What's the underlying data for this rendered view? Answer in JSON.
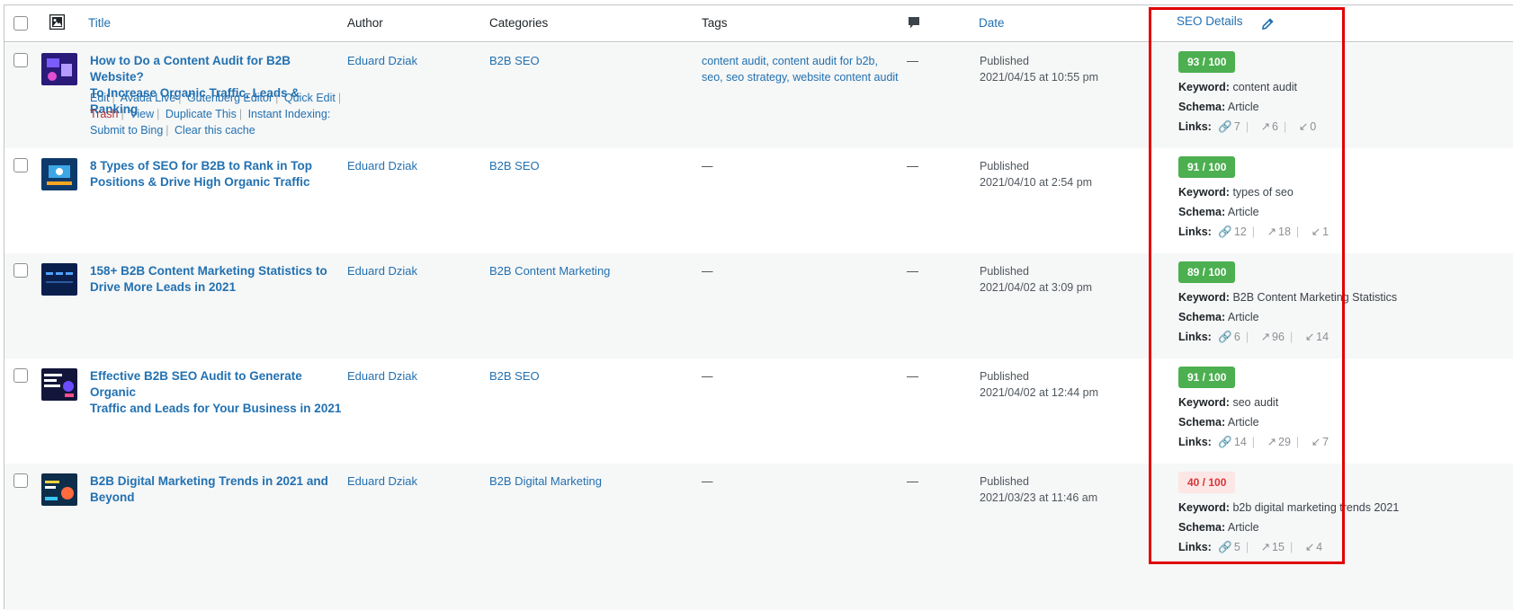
{
  "header": {
    "title": "Title",
    "author": "Author",
    "categories": "Categories",
    "tags": "Tags",
    "date": "Date",
    "seo_details": "SEO Details"
  },
  "rows": [
    {
      "title_line1": "How to Do a Content Audit for B2B Website?",
      "title_line2": "To Increase Organic Traffic, Leads & Ranking",
      "author": "Eduard Dziak",
      "category": "B2B SEO",
      "tags_line1": "content audit, content audit for b2b,",
      "tags_line2": "seo, seo strategy, website content audit",
      "comments": "—",
      "status": "Published",
      "date": "2021/04/15 at 10:55 pm",
      "score": "93 / 100",
      "keyword": "content audit",
      "schema": "Article",
      "links_internal": "7",
      "links_external": "6",
      "links_incoming": "0"
    },
    {
      "title_line1": "8 Types of SEO for B2B to Rank in Top",
      "title_line2": "Positions & Drive High Organic Traffic",
      "author": "Eduard Dziak",
      "category": "B2B SEO",
      "tags_line1": "—",
      "tags_line2": "",
      "comments": "—",
      "status": "Published",
      "date": "2021/04/10 at 2:54 pm",
      "score": "91 / 100",
      "keyword": "types of seo",
      "schema": "Article",
      "links_internal": "12",
      "links_external": "18",
      "links_incoming": "1"
    },
    {
      "title_line1": "158+ B2B Content Marketing Statistics to",
      "title_line2": "Drive More Leads in 2021",
      "author": "Eduard Dziak",
      "category": "B2B Content Marketing",
      "tags_line1": "—",
      "tags_line2": "",
      "comments": "—",
      "status": "Published",
      "date": "2021/04/02 at 3:09 pm",
      "score": "89 / 100",
      "keyword": "B2B Content Marketing Statistics",
      "schema": "Article",
      "links_internal": "6",
      "links_external": "96",
      "links_incoming": "14"
    },
    {
      "title_line1": "Effective B2B SEO Audit to Generate Organic",
      "title_line2": "Traffic and Leads for Your Business in 2021",
      "author": "Eduard Dziak",
      "category": "B2B SEO",
      "tags_line1": "—",
      "tags_line2": "",
      "comments": "—",
      "status": "Published",
      "date": "2021/04/02 at 12:44 pm",
      "score": "91 / 100",
      "keyword": "seo audit",
      "schema": "Article",
      "links_internal": "14",
      "links_external": "29",
      "links_incoming": "7"
    },
    {
      "title_line1": "B2B Digital Marketing Trends in 2021 and",
      "title_line2": "Beyond",
      "author": "Eduard Dziak",
      "category": "B2B Digital Marketing",
      "tags_line1": "—",
      "tags_line2": "",
      "comments": "—",
      "status": "Published",
      "date": "2021/03/23 at 11:46 am",
      "score": "40 / 100",
      "keyword": "b2b digital marketing trends 2021",
      "schema": "Article",
      "links_internal": "5",
      "links_external": "15",
      "links_incoming": "4"
    }
  ],
  "row_actions": {
    "edit": "Edit",
    "avada_live": "Avada Live",
    "gutenberg": "Gutenberg Editor",
    "quick_edit": "Quick Edit",
    "trash": "Trash",
    "view": "View",
    "duplicate": "Duplicate This",
    "instant_indexing": "Instant Indexing:",
    "submit_bing": "Submit to Bing",
    "clear_cache": "Clear this cache"
  },
  "labels": {
    "keyword": "Keyword:",
    "schema": "Schema:",
    "links": "Links:"
  },
  "colors": {
    "accent": "#2271b1",
    "good_score": "#4caf50",
    "bad_score_bg": "#fde6e6",
    "bad_score_text": "#d63638",
    "highlight_box": "#e00000"
  }
}
